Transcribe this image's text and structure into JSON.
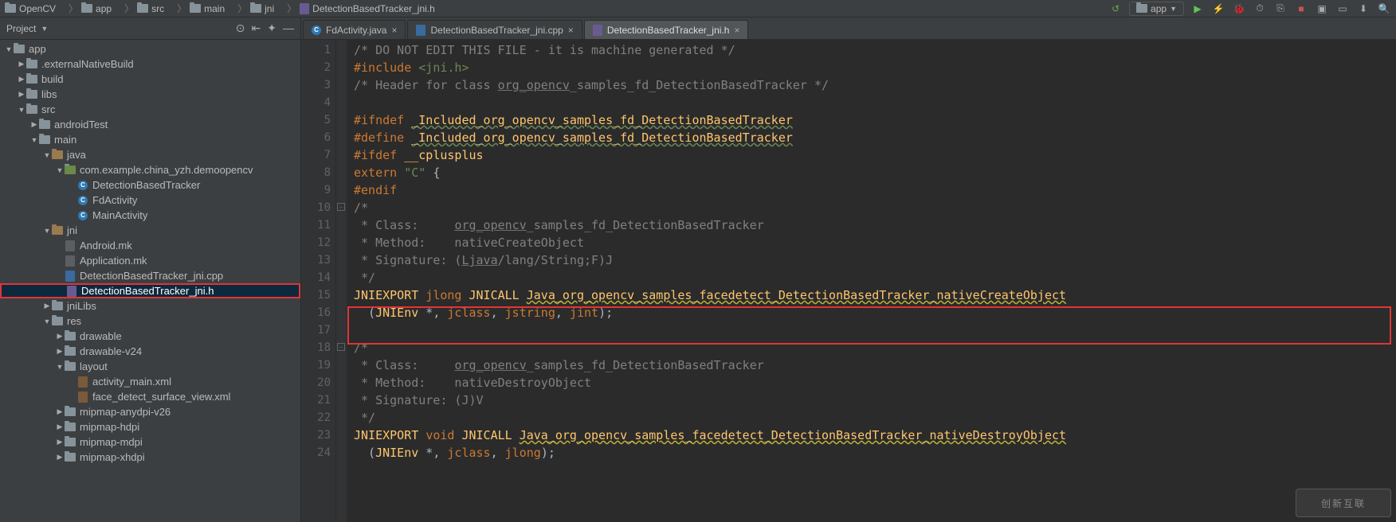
{
  "breadcrumbs": [
    {
      "kind": "module",
      "label": "OpenCV"
    },
    {
      "kind": "module",
      "label": "app"
    },
    {
      "kind": "folder",
      "label": "src"
    },
    {
      "kind": "folder",
      "label": "main"
    },
    {
      "kind": "folder",
      "label": "jni"
    },
    {
      "kind": "file-h",
      "label": "DetectionBasedTracker_jni.h"
    }
  ],
  "run_config": {
    "module": "app"
  },
  "sidebar": {
    "title": "Project",
    "tree": [
      {
        "depth": 0,
        "arrow": "down",
        "ico": "module",
        "label": "app"
      },
      {
        "depth": 1,
        "arrow": "right",
        "ico": "folder",
        "label": ".externalNativeBuild"
      },
      {
        "depth": 1,
        "arrow": "right",
        "ico": "folder",
        "label": "build"
      },
      {
        "depth": 1,
        "arrow": "right",
        "ico": "folder",
        "label": "libs"
      },
      {
        "depth": 1,
        "arrow": "down",
        "ico": "folder",
        "label": "src"
      },
      {
        "depth": 2,
        "arrow": "right",
        "ico": "folder",
        "label": "androidTest"
      },
      {
        "depth": 2,
        "arrow": "down",
        "ico": "folder",
        "label": "main"
      },
      {
        "depth": 3,
        "arrow": "down",
        "ico": "folder-src",
        "label": "java"
      },
      {
        "depth": 4,
        "arrow": "down",
        "ico": "package",
        "label": "com.example.china_yzh.demoopencv"
      },
      {
        "depth": 5,
        "arrow": "none",
        "ico": "class",
        "label": "DetectionBasedTracker"
      },
      {
        "depth": 5,
        "arrow": "none",
        "ico": "class",
        "label": "FdActivity"
      },
      {
        "depth": 5,
        "arrow": "none",
        "ico": "class",
        "label": "MainActivity"
      },
      {
        "depth": 3,
        "arrow": "down",
        "ico": "folder-src",
        "label": "jni"
      },
      {
        "depth": 4,
        "arrow": "none",
        "ico": "file-mk",
        "label": "Android.mk"
      },
      {
        "depth": 4,
        "arrow": "none",
        "ico": "file-mk",
        "label": "Application.mk"
      },
      {
        "depth": 4,
        "arrow": "none",
        "ico": "file-cpp",
        "label": "DetectionBasedTracker_jni.cpp"
      },
      {
        "depth": 4,
        "arrow": "none",
        "ico": "file-h",
        "label": "DetectionBasedTracker_jni.h",
        "selected": true,
        "redbox": true
      },
      {
        "depth": 3,
        "arrow": "right",
        "ico": "folder",
        "label": "jniLibs"
      },
      {
        "depth": 3,
        "arrow": "down",
        "ico": "folder-res",
        "label": "res"
      },
      {
        "depth": 4,
        "arrow": "right",
        "ico": "folder",
        "label": "drawable"
      },
      {
        "depth": 4,
        "arrow": "right",
        "ico": "folder",
        "label": "drawable-v24"
      },
      {
        "depth": 4,
        "arrow": "down",
        "ico": "folder",
        "label": "layout"
      },
      {
        "depth": 5,
        "arrow": "none",
        "ico": "file-xml",
        "label": "activity_main.xml"
      },
      {
        "depth": 5,
        "arrow": "none",
        "ico": "file-xml",
        "label": "face_detect_surface_view.xml"
      },
      {
        "depth": 4,
        "arrow": "right",
        "ico": "folder",
        "label": "mipmap-anydpi-v26"
      },
      {
        "depth": 4,
        "arrow": "right",
        "ico": "folder",
        "label": "mipmap-hdpi"
      },
      {
        "depth": 4,
        "arrow": "right",
        "ico": "folder",
        "label": "mipmap-mdpi"
      },
      {
        "depth": 4,
        "arrow": "right",
        "ico": "folder",
        "label": "mipmap-xhdpi"
      }
    ]
  },
  "tabs": [
    {
      "label": "FdActivity.java",
      "ico": "class",
      "active": false
    },
    {
      "label": "DetectionBasedTracker_jni.cpp",
      "ico": "file-cpp",
      "active": false
    },
    {
      "label": "DetectionBasedTracker_jni.h",
      "ico": "file-h",
      "active": true
    }
  ],
  "code": {
    "first_line": 1,
    "highlight_line": 15,
    "lines": [
      {
        "n": 1,
        "seg": [
          {
            "c": "cm",
            "t": "/* DO NOT EDIT THIS FILE - it is machine generated */"
          }
        ]
      },
      {
        "n": 2,
        "seg": [
          {
            "c": "pp",
            "t": "#include "
          },
          {
            "c": "ang",
            "t": "<jni.h>"
          }
        ]
      },
      {
        "n": 3,
        "seg": [
          {
            "c": "cm",
            "t": "/* Header for class "
          },
          {
            "c": "cm und",
            "t": "org_opencv"
          },
          {
            "c": "cm",
            "t": "_samples_fd_DetectionBasedTracker */"
          }
        ]
      },
      {
        "n": 4,
        "seg": []
      },
      {
        "n": 5,
        "seg": [
          {
            "c": "pp",
            "t": "#ifndef "
          },
          {
            "c": "id-y squig-g",
            "t": "_Included_org_opencv_samples_fd_DetectionBasedTracker"
          }
        ]
      },
      {
        "n": 6,
        "seg": [
          {
            "c": "pp",
            "t": "#define "
          },
          {
            "c": "id-y squig-g",
            "t": "_Included_org_opencv_samples_fd_DetectionBasedTracker"
          }
        ]
      },
      {
        "n": 7,
        "seg": [
          {
            "c": "pp",
            "t": "#ifdef "
          },
          {
            "c": "id-y",
            "t": "__cplusplus"
          }
        ]
      },
      {
        "n": 8,
        "seg": [
          {
            "c": "kw",
            "t": "extern "
          },
          {
            "c": "str",
            "t": "\"C\""
          },
          {
            "c": "id-g",
            "t": " {"
          }
        ]
      },
      {
        "n": 9,
        "seg": [
          {
            "c": "pp",
            "t": "#endif"
          }
        ]
      },
      {
        "n": 10,
        "fold": "open",
        "seg": [
          {
            "c": "cm",
            "t": "/*"
          }
        ]
      },
      {
        "n": 11,
        "seg": [
          {
            "c": "cm",
            "t": " * Class:     "
          },
          {
            "c": "cm und",
            "t": "org_opencv"
          },
          {
            "c": "cm",
            "t": "_samples_fd_DetectionBasedTracker"
          }
        ]
      },
      {
        "n": 12,
        "seg": [
          {
            "c": "cm",
            "t": " * Method:    nativeCreateObject"
          }
        ]
      },
      {
        "n": 13,
        "seg": [
          {
            "c": "cm",
            "t": " * Signature: ("
          },
          {
            "c": "cm und",
            "t": "Ljava"
          },
          {
            "c": "cm",
            "t": "/lang/String;F)J"
          }
        ]
      },
      {
        "n": 14,
        "seg": [
          {
            "c": "cm",
            "t": " */"
          }
        ]
      },
      {
        "n": 15,
        "flip": true,
        "seg": [
          {
            "c": "id-y",
            "t": "JNIEXPORT "
          },
          {
            "c": "kw",
            "t": "jlong "
          },
          {
            "c": "id-y",
            "t": "JNICALL "
          },
          {
            "c": "id-y squig-y",
            "t": "Java_org_opencv_samples_facedetect_DetectionBasedTracker_nativeCreateObject"
          }
        ]
      },
      {
        "n": 16,
        "seg": [
          {
            "c": "id-g",
            "t": "  ("
          },
          {
            "c": "id-y",
            "t": "JNIEnv"
          },
          {
            "c": "id-g",
            "t": " *, "
          },
          {
            "c": "kw",
            "t": "jclass"
          },
          {
            "c": "id-g",
            "t": ", "
          },
          {
            "c": "kw",
            "t": "jstring"
          },
          {
            "c": "id-g",
            "t": ", "
          },
          {
            "c": "kw",
            "t": "jint"
          },
          {
            "c": "id-g",
            "t": ");"
          }
        ]
      },
      {
        "n": 17,
        "seg": []
      },
      {
        "n": 18,
        "fold": "open",
        "seg": [
          {
            "c": "cm",
            "t": "/*"
          }
        ]
      },
      {
        "n": 19,
        "seg": [
          {
            "c": "cm",
            "t": " * Class:     "
          },
          {
            "c": "cm und",
            "t": "org_opencv"
          },
          {
            "c": "cm",
            "t": "_samples_fd_DetectionBasedTracker"
          }
        ]
      },
      {
        "n": 20,
        "seg": [
          {
            "c": "cm",
            "t": " * Method:    nativeDestroyObject"
          }
        ]
      },
      {
        "n": 21,
        "seg": [
          {
            "c": "cm",
            "t": " * Signature: (J)V"
          }
        ]
      },
      {
        "n": 22,
        "seg": [
          {
            "c": "cm",
            "t": " */"
          }
        ]
      },
      {
        "n": 23,
        "flip": true,
        "seg": [
          {
            "c": "id-y",
            "t": "JNIEXPORT "
          },
          {
            "c": "kw",
            "t": "void "
          },
          {
            "c": "id-y",
            "t": "JNICALL "
          },
          {
            "c": "id-y squig-y",
            "t": "Java_org_opencv_samples_facedetect_DetectionBasedTracker_nativeDestroyObject"
          }
        ]
      },
      {
        "n": 24,
        "seg": [
          {
            "c": "id-g",
            "t": "  ("
          },
          {
            "c": "id-y",
            "t": "JNIEnv"
          },
          {
            "c": "id-g",
            "t": " *, "
          },
          {
            "c": "kw",
            "t": "jclass"
          },
          {
            "c": "id-g",
            "t": ", "
          },
          {
            "c": "kw",
            "t": "jlong"
          },
          {
            "c": "id-g",
            "t": ");"
          }
        ]
      }
    ]
  },
  "watermark": "创新互联"
}
